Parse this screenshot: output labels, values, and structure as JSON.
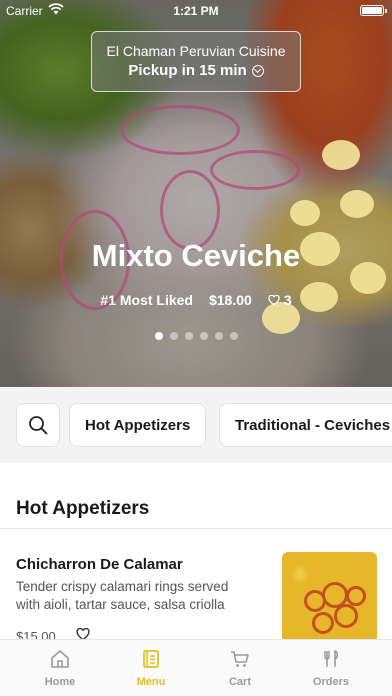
{
  "status_bar": {
    "carrier": "Carrier",
    "time": "1:21 PM"
  },
  "restaurant": {
    "name": "El Chaman Peruvian Cuisine",
    "pickup": "Pickup in 15 min"
  },
  "hero": {
    "title": "Mixto Ceviche",
    "badge": "#1 Most Liked",
    "price": "$18.00",
    "likes": "3",
    "carousel": {
      "count": 6,
      "active_index": 0
    }
  },
  "categories": [
    "Hot Appetizers",
    "Traditional - Ceviches"
  ],
  "section": {
    "title": "Hot Appetizers"
  },
  "items": [
    {
      "name": "Chicharron De Calamar",
      "description": "Tender crispy calamari rings served with aioli, tartar sauce, salsa criolla",
      "price": "$15.00"
    }
  ],
  "tabs": [
    {
      "label": "Home",
      "icon": "home-icon",
      "active": false
    },
    {
      "label": "Menu",
      "icon": "menu-book-icon",
      "active": true
    },
    {
      "label": "Cart",
      "icon": "cart-icon",
      "active": false
    },
    {
      "label": "Orders",
      "icon": "utensils-icon",
      "active": false
    }
  ],
  "colors": {
    "accent": "#e6bd1c",
    "tab_inactive": "#9a9a9a",
    "category_bar_bg": "#f4f4f4"
  }
}
